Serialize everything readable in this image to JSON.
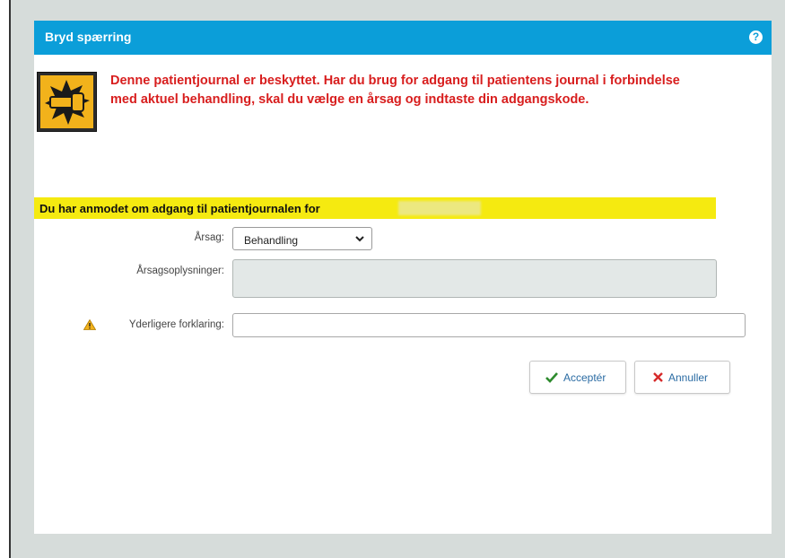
{
  "dialog": {
    "title": "Bryd spærring",
    "help_icon": "?",
    "warning_message": "Denne patientjournal er beskyttet. Har du brug for adgang til patientens journal i forbindelse med aktuel behandling, skal du vælge en årsag og indtaste din adgangskode.",
    "request_text": "Du har anmodet om adgang til patientjournalen for",
    "form": {
      "reason_label": "Årsag:",
      "reason_value": "Behandling",
      "reason_details_label": "Årsagsoplysninger:",
      "reason_details_value": "",
      "extra_explanation_label": "Yderligere forklaring:",
      "extra_explanation_value": ""
    },
    "buttons": {
      "accept_label": "Acceptér",
      "cancel_label": "Annuller"
    }
  },
  "colors": {
    "titlebar": "#0b9ed9",
    "warning_text": "#d81e1e",
    "highlight": "#f5ea10",
    "accept_check": "#2e8b2e",
    "cancel_x": "#d62a2a",
    "backdrop": "#d6dcda"
  },
  "icons": {
    "help": "help-icon",
    "protected_journal": "protected-journal-icon",
    "warning": "warning-triangle-icon",
    "accept": "checkmark-icon",
    "cancel": "close-x-icon",
    "dropdown": "chevron-down-icon"
  }
}
